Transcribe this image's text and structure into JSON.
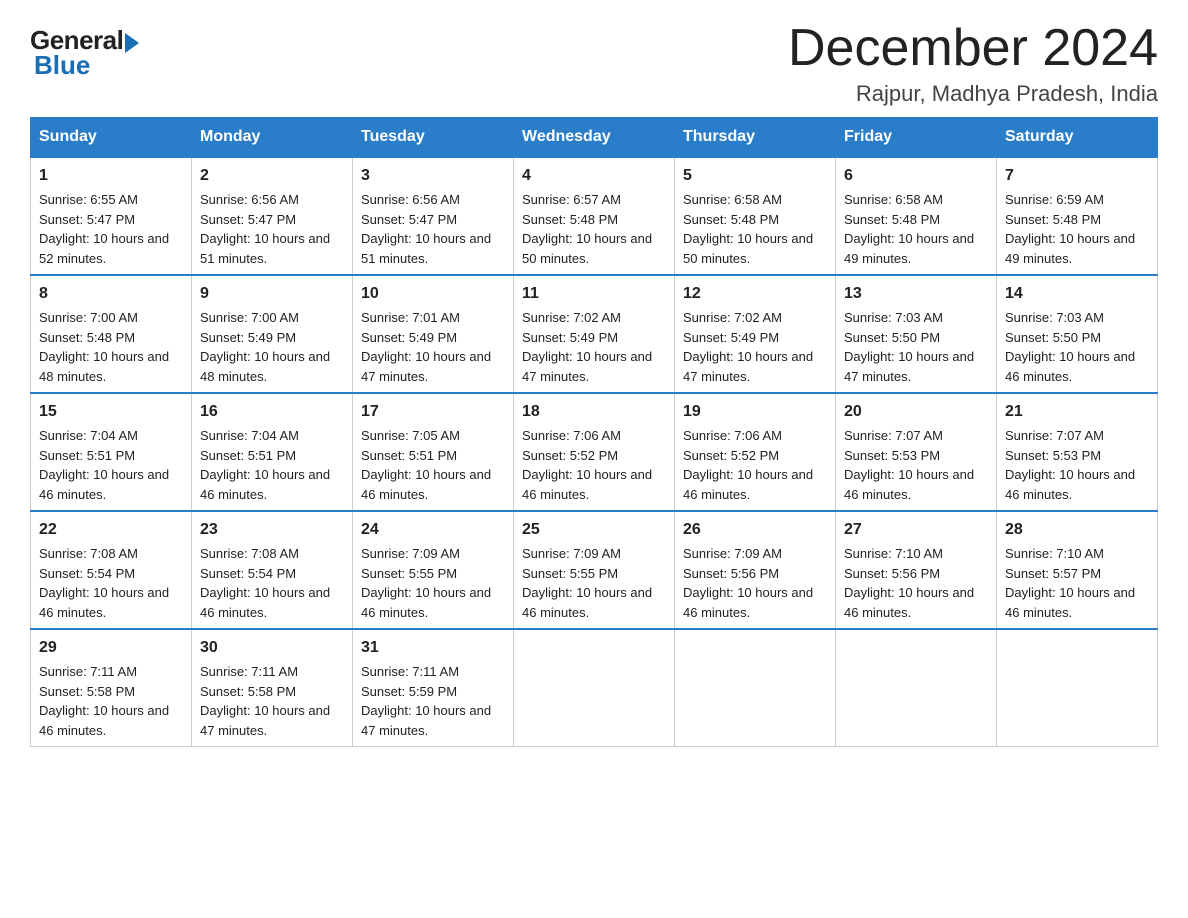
{
  "logo": {
    "general": "General",
    "blue": "Blue"
  },
  "header": {
    "month_year": "December 2024",
    "location": "Rajpur, Madhya Pradesh, India"
  },
  "weekdays": [
    "Sunday",
    "Monday",
    "Tuesday",
    "Wednesday",
    "Thursday",
    "Friday",
    "Saturday"
  ],
  "weeks": [
    [
      {
        "day": "1",
        "sunrise": "6:55 AM",
        "sunset": "5:47 PM",
        "daylight": "10 hours and 52 minutes."
      },
      {
        "day": "2",
        "sunrise": "6:56 AM",
        "sunset": "5:47 PM",
        "daylight": "10 hours and 51 minutes."
      },
      {
        "day": "3",
        "sunrise": "6:56 AM",
        "sunset": "5:47 PM",
        "daylight": "10 hours and 51 minutes."
      },
      {
        "day": "4",
        "sunrise": "6:57 AM",
        "sunset": "5:48 PM",
        "daylight": "10 hours and 50 minutes."
      },
      {
        "day": "5",
        "sunrise": "6:58 AM",
        "sunset": "5:48 PM",
        "daylight": "10 hours and 50 minutes."
      },
      {
        "day": "6",
        "sunrise": "6:58 AM",
        "sunset": "5:48 PM",
        "daylight": "10 hours and 49 minutes."
      },
      {
        "day": "7",
        "sunrise": "6:59 AM",
        "sunset": "5:48 PM",
        "daylight": "10 hours and 49 minutes."
      }
    ],
    [
      {
        "day": "8",
        "sunrise": "7:00 AM",
        "sunset": "5:48 PM",
        "daylight": "10 hours and 48 minutes."
      },
      {
        "day": "9",
        "sunrise": "7:00 AM",
        "sunset": "5:49 PM",
        "daylight": "10 hours and 48 minutes."
      },
      {
        "day": "10",
        "sunrise": "7:01 AM",
        "sunset": "5:49 PM",
        "daylight": "10 hours and 47 minutes."
      },
      {
        "day": "11",
        "sunrise": "7:02 AM",
        "sunset": "5:49 PM",
        "daylight": "10 hours and 47 minutes."
      },
      {
        "day": "12",
        "sunrise": "7:02 AM",
        "sunset": "5:49 PM",
        "daylight": "10 hours and 47 minutes."
      },
      {
        "day": "13",
        "sunrise": "7:03 AM",
        "sunset": "5:50 PM",
        "daylight": "10 hours and 47 minutes."
      },
      {
        "day": "14",
        "sunrise": "7:03 AM",
        "sunset": "5:50 PM",
        "daylight": "10 hours and 46 minutes."
      }
    ],
    [
      {
        "day": "15",
        "sunrise": "7:04 AM",
        "sunset": "5:51 PM",
        "daylight": "10 hours and 46 minutes."
      },
      {
        "day": "16",
        "sunrise": "7:04 AM",
        "sunset": "5:51 PM",
        "daylight": "10 hours and 46 minutes."
      },
      {
        "day": "17",
        "sunrise": "7:05 AM",
        "sunset": "5:51 PM",
        "daylight": "10 hours and 46 minutes."
      },
      {
        "day": "18",
        "sunrise": "7:06 AM",
        "sunset": "5:52 PM",
        "daylight": "10 hours and 46 minutes."
      },
      {
        "day": "19",
        "sunrise": "7:06 AM",
        "sunset": "5:52 PM",
        "daylight": "10 hours and 46 minutes."
      },
      {
        "day": "20",
        "sunrise": "7:07 AM",
        "sunset": "5:53 PM",
        "daylight": "10 hours and 46 minutes."
      },
      {
        "day": "21",
        "sunrise": "7:07 AM",
        "sunset": "5:53 PM",
        "daylight": "10 hours and 46 minutes."
      }
    ],
    [
      {
        "day": "22",
        "sunrise": "7:08 AM",
        "sunset": "5:54 PM",
        "daylight": "10 hours and 46 minutes."
      },
      {
        "day": "23",
        "sunrise": "7:08 AM",
        "sunset": "5:54 PM",
        "daylight": "10 hours and 46 minutes."
      },
      {
        "day": "24",
        "sunrise": "7:09 AM",
        "sunset": "5:55 PM",
        "daylight": "10 hours and 46 minutes."
      },
      {
        "day": "25",
        "sunrise": "7:09 AM",
        "sunset": "5:55 PM",
        "daylight": "10 hours and 46 minutes."
      },
      {
        "day": "26",
        "sunrise": "7:09 AM",
        "sunset": "5:56 PM",
        "daylight": "10 hours and 46 minutes."
      },
      {
        "day": "27",
        "sunrise": "7:10 AM",
        "sunset": "5:56 PM",
        "daylight": "10 hours and 46 minutes."
      },
      {
        "day": "28",
        "sunrise": "7:10 AM",
        "sunset": "5:57 PM",
        "daylight": "10 hours and 46 minutes."
      }
    ],
    [
      {
        "day": "29",
        "sunrise": "7:11 AM",
        "sunset": "5:58 PM",
        "daylight": "10 hours and 46 minutes."
      },
      {
        "day": "30",
        "sunrise": "7:11 AM",
        "sunset": "5:58 PM",
        "daylight": "10 hours and 47 minutes."
      },
      {
        "day": "31",
        "sunrise": "7:11 AM",
        "sunset": "5:59 PM",
        "daylight": "10 hours and 47 minutes."
      },
      null,
      null,
      null,
      null
    ]
  ]
}
